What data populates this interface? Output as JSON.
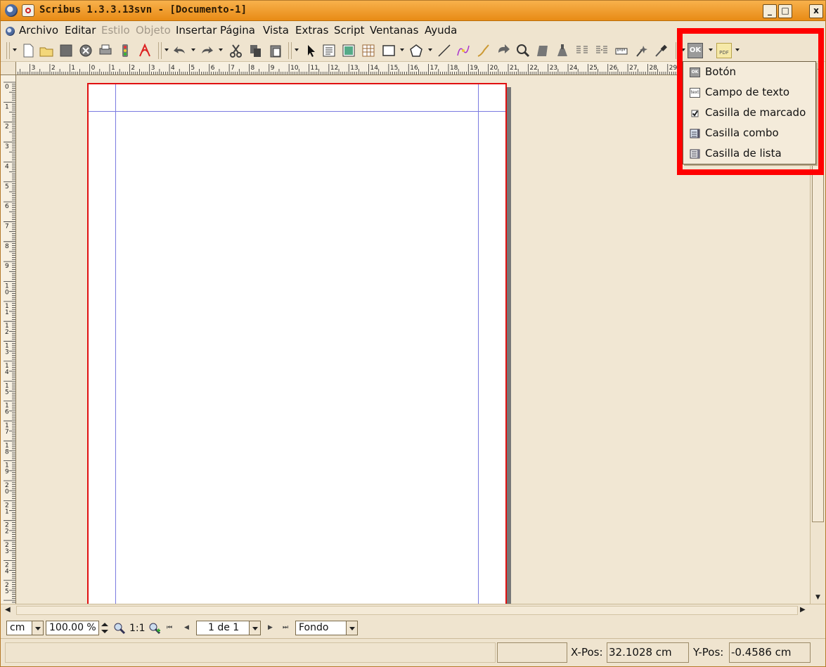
{
  "window": {
    "title": "Scribus 1.3.3.13svn - [Documento-1]",
    "controls": {
      "minimize": "_",
      "maximize": "□",
      "close": "x"
    }
  },
  "menubar": {
    "items": [
      {
        "label": "Archivo",
        "enabled": true
      },
      {
        "label": "Editar",
        "enabled": true
      },
      {
        "label": "Estilo",
        "enabled": false
      },
      {
        "label": "Objeto",
        "enabled": false
      },
      {
        "label": "Insertar",
        "enabled": true
      },
      {
        "label": "Página",
        "enabled": true
      },
      {
        "label": "Vista",
        "enabled": true
      },
      {
        "label": "Extras",
        "enabled": true
      },
      {
        "label": "Script",
        "enabled": true
      },
      {
        "label": "Ventanas",
        "enabled": true
      },
      {
        "label": "Ayuda",
        "enabled": true
      }
    ]
  },
  "toolbar": {
    "icons": [
      "new-document-icon",
      "open-folder-icon",
      "save-icon",
      "close-document-icon",
      "print-icon",
      "preflight-icon",
      "export-pdf-icon",
      "undo-icon",
      "redo-icon",
      "cut-icon",
      "copy-icon",
      "paste-icon",
      "select-icon",
      "text-frame-icon",
      "image-frame-icon",
      "table-icon",
      "shape-icon",
      "polygon-icon",
      "line-icon",
      "bezier-icon",
      "freehand-icon",
      "rotate-icon",
      "zoom-icon",
      "edit-contents-icon",
      "edit-text-icon",
      "link-frames-icon",
      "unlink-frames-icon",
      "measure-icon",
      "copy-properties-icon",
      "eyedropper-icon",
      "pdf-button-tool-icon",
      "pdf-annotation-tool-icon"
    ],
    "pdf_button_label": "OK",
    "pdf_annot_label": "PDF"
  },
  "ruler_top": {
    "labels": [
      "3",
      "2",
      "1",
      "0",
      "1",
      "2",
      "3",
      "4",
      "5",
      "6",
      "7",
      "8",
      "9",
      "10",
      "11",
      "12",
      "13",
      "14",
      "15",
      "16",
      "17",
      "18",
      "19",
      "20",
      "21",
      "22",
      "23",
      "24",
      "25",
      "26",
      "27",
      "28",
      "29"
    ]
  },
  "ruler_left": {
    "labels": [
      "0",
      "1",
      "2",
      "3",
      "4",
      "5",
      "6",
      "7",
      "8",
      "9",
      "10",
      "11",
      "12",
      "13",
      "14",
      "15",
      "16",
      "17",
      "18",
      "19",
      "20",
      "21",
      "22",
      "23",
      "24",
      "25"
    ]
  },
  "dropdown": {
    "items": [
      {
        "label": "Botón",
        "icon": "pdf-button-icon"
      },
      {
        "label": "Campo de texto",
        "icon": "pdf-text-field-icon"
      },
      {
        "label": "Casilla de marcado",
        "icon": "pdf-checkbox-icon"
      },
      {
        "label": "Casilla combo",
        "icon": "pdf-combo-box-icon"
      },
      {
        "label": "Casilla de lista",
        "icon": "pdf-list-box-icon"
      }
    ]
  },
  "navbar": {
    "unit": "cm",
    "zoom": "100.00 %",
    "zoom_1to1": "1:1",
    "page": "1 de 1",
    "layer": "Fondo"
  },
  "statusbar": {
    "xpos_label": "X-Pos:",
    "xpos_value": "32.1028 cm",
    "ypos_label": "Y-Pos:",
    "ypos_value": "-0.4586 cm"
  },
  "colors": {
    "titlebar": "#f0a030",
    "background": "#efe4cf",
    "page_border": "#e01010",
    "guides": "#7a7ae0",
    "highlight": "#ff0000"
  }
}
